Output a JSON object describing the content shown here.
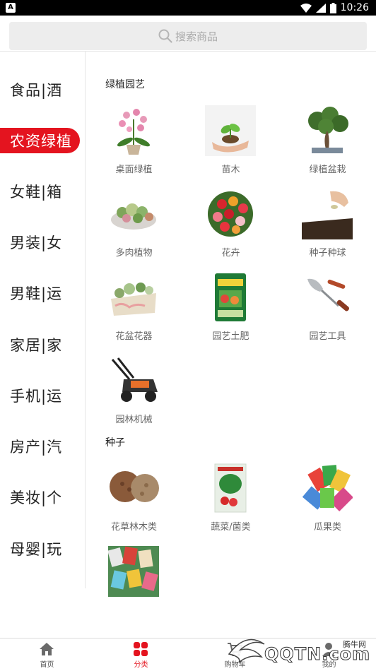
{
  "status_bar": {
    "time": "10:26"
  },
  "search": {
    "placeholder": "搜索商品"
  },
  "sidebar": {
    "items": [
      {
        "label": "食品|酒"
      },
      {
        "label": "农资绿植",
        "active": true
      },
      {
        "label": "女鞋|箱"
      },
      {
        "label": "男装|女"
      },
      {
        "label": "男鞋|运"
      },
      {
        "label": "家居|家"
      },
      {
        "label": "手机|运"
      },
      {
        "label": "房产|汽"
      },
      {
        "label": "美妆|个"
      },
      {
        "label": "母婴|玩"
      }
    ]
  },
  "sections": [
    {
      "title": "绿植园艺",
      "items": [
        {
          "label": "桌面绿植",
          "icon": "orchid-plant-icon"
        },
        {
          "label": "苗木",
          "icon": "seedling-hands-icon"
        },
        {
          "label": "绿植盆栽",
          "icon": "bonsai-tree-icon"
        },
        {
          "label": "多肉植物",
          "icon": "succulent-pot-icon"
        },
        {
          "label": "花卉",
          "icon": "rose-bouquet-icon"
        },
        {
          "label": "种子种球",
          "icon": "seed-soil-icon"
        },
        {
          "label": "花盆花器",
          "icon": "planter-box-icon"
        },
        {
          "label": "园艺土肥",
          "icon": "fertilizer-bag-icon"
        },
        {
          "label": "园艺工具",
          "icon": "garden-tools-icon"
        },
        {
          "label": "园林机械",
          "icon": "lawn-mower-icon"
        }
      ]
    },
    {
      "title": "种子",
      "items": [
        {
          "label": "花草林木类",
          "icon": "seed-piles-icon"
        },
        {
          "label": "蔬菜/菌类",
          "icon": "vegetable-seed-pack-icon"
        },
        {
          "label": "瓜果类",
          "icon": "seed-packets-fan-icon"
        },
        {
          "label": "",
          "icon": "seed-packets-pile-icon"
        }
      ]
    }
  ],
  "tabbar": {
    "tabs": [
      {
        "label": "首页",
        "icon": "home-icon"
      },
      {
        "label": "分类",
        "icon": "category-grid-icon",
        "active": true
      },
      {
        "label": "购物车",
        "icon": "cart-icon"
      },
      {
        "label": "我的",
        "icon": "user-icon"
      }
    ]
  },
  "watermark": {
    "text": "腾牛网",
    "logo_text": "QQTN.com"
  },
  "colors": {
    "accent": "#e4141f",
    "sidebar_text": "#222222",
    "label_text": "#666666"
  }
}
